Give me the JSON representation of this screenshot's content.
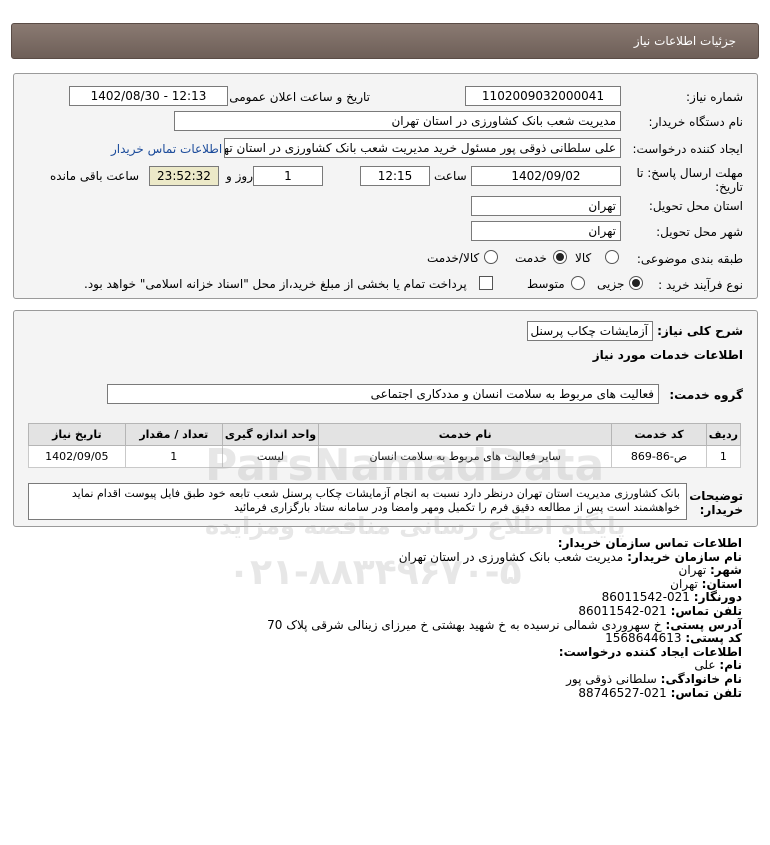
{
  "header": {
    "title": "جزئیات اطلاعات نیاز"
  },
  "form": {
    "need_number_label": "شماره نیاز:",
    "need_number": "1102009032000041",
    "announce_label": "تاریخ و ساعت اعلان عمومی:",
    "announce_value": "1402/08/30 - 12:13",
    "buyer_org_label": "نام دستگاه خریدار:",
    "buyer_org": "مدیریت شعب بانک کشاورزی در استان تهران",
    "creator_label": "ایجاد کننده درخواست:",
    "creator": "علی سلطانی ذوقی پور مسئول خرید مدیریت شعب بانک کشاورزی در استان تهران",
    "contact_link": "اطلاعات تماس خریدار",
    "deadline_label_1": "مهلت ارسال پاسخ: تا",
    "deadline_label_2": "تاریخ:",
    "deadline_date": "1402/09/02",
    "time_label": "ساعت",
    "deadline_time": "12:15",
    "days_value": "1",
    "days_label": "روز و",
    "remaining_time": "23:52:32",
    "remaining_label": "ساعت باقی مانده",
    "province_label": "استان محل تحویل:",
    "province": "تهران",
    "city_label": "شهر محل تحویل:",
    "city": "تهران",
    "category_label": "طبقه بندی موضوعی:",
    "category_options": [
      "کالا",
      "خدمت",
      "کالا/خدمت"
    ],
    "category_selected": "خدمت",
    "process_label": "نوع فرآیند خرید :",
    "process_options": [
      "جزیی",
      "متوسط"
    ],
    "process_selected": "جزیی",
    "treasury_note": "پرداخت تمام یا بخشی از مبلغ خرید،از محل \"اسناد خزانه اسلامی\" خواهد بود."
  },
  "summary": {
    "label": "شرح کلی نیاز:",
    "value": "آزمایشات چکاب پرسنل",
    "services_title": "اطلاعات خدمات مورد نیاز",
    "group_label": "گروه خدمت:",
    "group_value": "فعالیت های مربوط به سلامت انسان و مددکاری اجتماعی"
  },
  "table": {
    "headers": [
      "ردیف",
      "کد خدمت",
      "نام خدمت",
      "واحد اندازه گیری",
      "تعداد / مقدار",
      "تاریخ نیاز"
    ],
    "rows": [
      [
        "1",
        "ص-86-869",
        "سایر فعالیت های مربوط به سلامت انسان",
        "لیست",
        "1",
        "1402/09/05"
      ]
    ]
  },
  "notes": {
    "label_1": "توضیحات",
    "label_2": "خریدار:",
    "text": "بانک کشاورزی مدیریت استان تهران درنظر دارد نسبت به انجام آزمایشات چکاب پرسنل شعب تابعه خود طبق فایل پیوست اقدام نماید خواهشمند است پس از مطالعه دقیق فرم را تکمیل ومهر وامضا ودر سامانه ستاد بارگزاری فرمائید"
  },
  "contact": {
    "title": "اطلاعات تماس سازمان خریدار:",
    "org_k": "نام سازمان خریدار:",
    "org_v": "مدیریت شعب بانک کشاورزی در استان تهران",
    "city_k": "شهر:",
    "city_v": "تهران",
    "province_k": "استان:",
    "province_v": "تهران",
    "fax_k": "دورنگار:",
    "fax_v": "021-86011542",
    "phone_k": "تلفن تماس:",
    "phone_v": "021-86011542",
    "address_k": "آدرس پستی:",
    "address_v": "خ سهروردی شمالی نرسیده به خ شهید بهشتی خ میرزای زینالی شرقی پلاک 70",
    "postal_k": "کد پستی:",
    "postal_v": "1568644613",
    "creator_title": "اطلاعات ایجاد کننده درخواست:",
    "name_k": "نام:",
    "name_v": "علی",
    "family_k": "نام خانوادگی:",
    "family_v": "سلطانی ذوقی پور",
    "cphone_k": "تلفن تماس:",
    "cphone_v": "021-88746527"
  },
  "watermark": {
    "brand": "ParsNamadData",
    "line": "پایگاه اطلاع رسانی مناقصه ومزایده",
    "phone": "۰۲۱-۸۸۳۴۹۶۷۰-۵"
  },
  "colors": {
    "header": "#7a6b63",
    "panel": "#f4f4f4",
    "link": "#1a4a9a",
    "remaining": "#ece9c8"
  }
}
